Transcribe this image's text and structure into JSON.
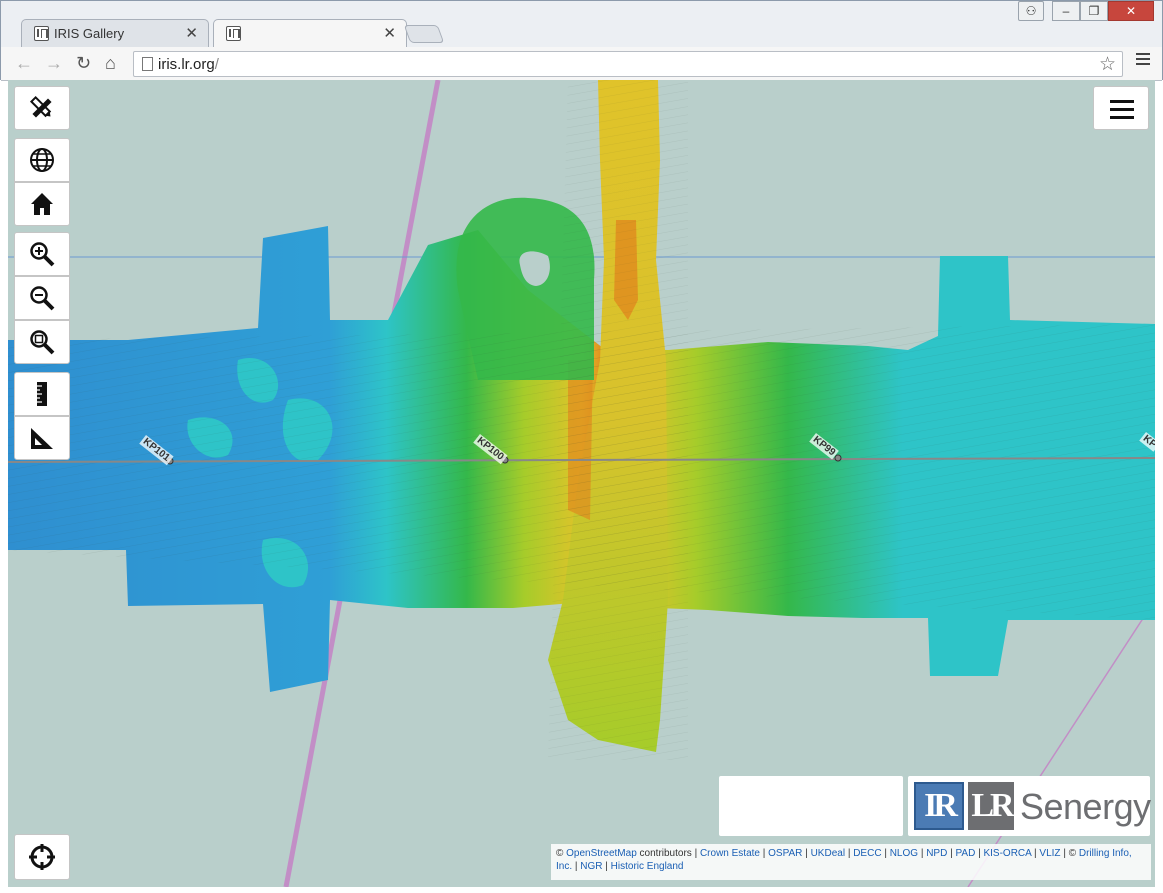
{
  "browser": {
    "tabs": [
      {
        "title": "IRIS Gallery",
        "active": false
      },
      {
        "title": "",
        "active": true
      }
    ],
    "url_host": "iris.lr.org",
    "url_path": "/"
  },
  "map": {
    "background_color": "#b9cfcb",
    "kp_markers": [
      "KP101",
      "KP100",
      "KP99",
      "KP"
    ],
    "controls": [
      {
        "name": "draw-tool",
        "icon": "pencil-ruler-icon"
      },
      {
        "name": "globe",
        "icon": "globe-icon"
      },
      {
        "name": "home",
        "icon": "home-icon"
      },
      {
        "name": "zoom-in",
        "icon": "zoom-in-icon"
      },
      {
        "name": "zoom-out",
        "icon": "zoom-out-icon"
      },
      {
        "name": "zoom-extent",
        "icon": "zoom-extent-icon"
      },
      {
        "name": "measure-distance",
        "icon": "ruler-icon"
      },
      {
        "name": "measure-area",
        "icon": "set-square-icon"
      }
    ],
    "locate_icon": "crosshair-icon",
    "menu_icon": "hamburger-icon"
  },
  "branding": {
    "logo1_text": "IR",
    "logo2_text": "LR",
    "brand_name": "Senergy"
  },
  "attribution": {
    "prefix": "©",
    "osm_link": "OpenStreetMap",
    "osm_suffix": "contributors |",
    "links": [
      "Crown Estate",
      "OSPAR",
      "UKDeal",
      "DECC",
      "NLOG",
      "NPD",
      "PAD",
      "KIS-ORCA",
      "VLIZ"
    ],
    "copyright2": "©",
    "link_drilling": "Drilling Info, Inc.",
    "link_ngr": "NGR",
    "link_he": "Historic England"
  },
  "colors": {
    "deep": "#2f8fd0",
    "shallow_cyan": "#2ec4c8",
    "green": "#34b84a",
    "yellow_green": "#a6cc2a",
    "yellow": "#e0c32a",
    "orange": "#e08a1e",
    "cable_line": "#c28ec6",
    "kp_line": "#888888"
  }
}
